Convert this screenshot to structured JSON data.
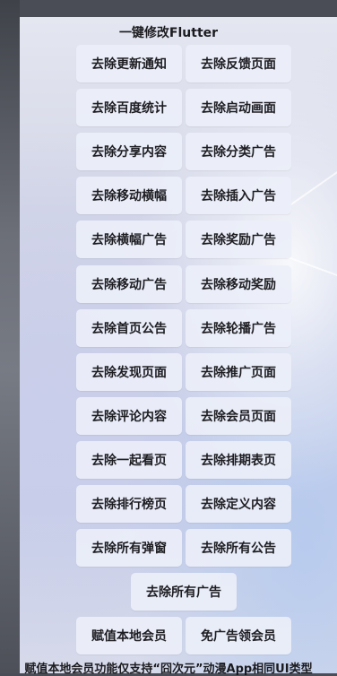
{
  "title": "一键修改Flutter",
  "buttons": [
    "去除更新通知",
    "去除反馈页面",
    "去除百度统计",
    "去除启动画面",
    "去除分享内容",
    "去除分类广告",
    "去除移动横幅",
    "去除插入广告",
    "去除横幅广告",
    "去除奖励广告",
    "去除移动广告",
    "去除移动奖励",
    "去除首页公告",
    "去除轮播广告",
    "去除发现页面",
    "去除推广页面",
    "去除评论内容",
    "去除会员页面",
    "去除一起看页",
    "去除排期表页",
    "去除排行榜页",
    "去除定义内容",
    "去除所有弹窗",
    "去除所有公告"
  ],
  "remove_all_ads": "去除所有广告",
  "assign_local_vip": "赋值本地会员",
  "ad_free_vip": "免广告领会员",
  "footer": "赋值本地会员功能仅支持“囧次元”动漫App相同UI类型"
}
